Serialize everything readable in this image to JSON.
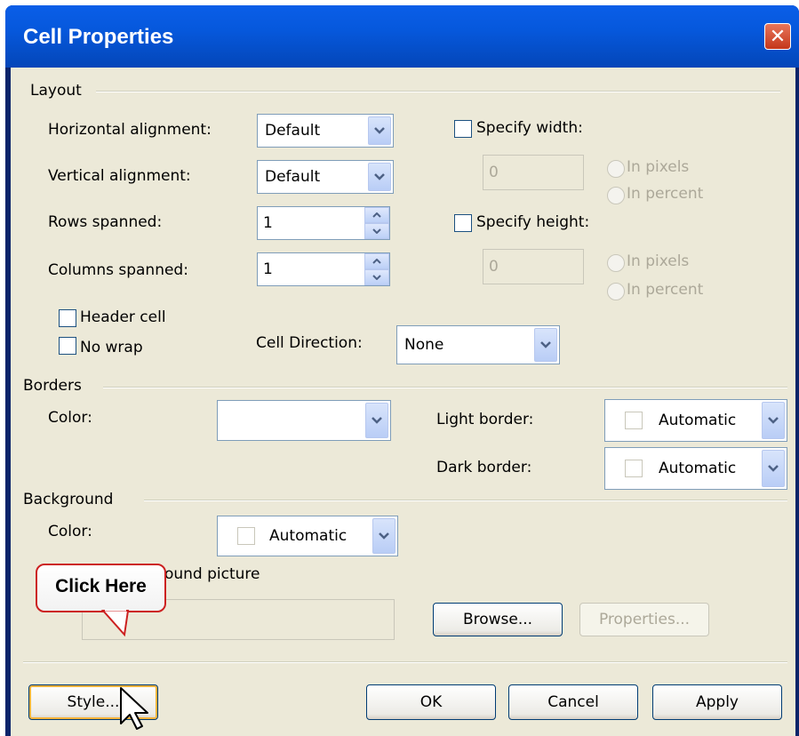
{
  "window": {
    "title": "Cell Properties"
  },
  "layout": {
    "group_label": "Layout",
    "horizontal_alignment": {
      "label": "Horizontal alignment:",
      "value": "Default"
    },
    "vertical_alignment": {
      "label": "Vertical alignment:",
      "value": "Default"
    },
    "rows_spanned": {
      "label": "Rows spanned:",
      "value": "1"
    },
    "columns_spanned": {
      "label": "Columns spanned:",
      "value": "1"
    },
    "specify_width": {
      "label": "Specify width:",
      "value": "0",
      "in_pixels": "In pixels",
      "in_percent": "In percent"
    },
    "specify_height": {
      "label": "Specify height:",
      "value": "0",
      "in_pixels": "In pixels",
      "in_percent": "In percent"
    },
    "header_cell": "Header cell",
    "no_wrap": "No wrap",
    "cell_direction": {
      "label": "Cell Direction:",
      "value": "None"
    }
  },
  "borders": {
    "group_label": "Borders",
    "color_label": "Color:",
    "color_value": "",
    "light_border": {
      "label": "Light border:",
      "value": "Automatic"
    },
    "dark_border": {
      "label": "Dark border:",
      "value": "Automatic"
    }
  },
  "background": {
    "group_label": "Background",
    "color_label": "Color:",
    "color_value": "Automatic",
    "use_picture": "Use background picture",
    "picture_path": "",
    "browse": "Browse...",
    "properties": "Properties..."
  },
  "buttons": {
    "style": "Style...",
    "ok": "OK",
    "cancel": "Cancel",
    "apply": "Apply"
  },
  "callout": {
    "text": "Click Here"
  },
  "colors": {
    "title_bar": "#0658dc",
    "dialog_bg": "#ece9d8",
    "callout_border": "#cc2020"
  }
}
